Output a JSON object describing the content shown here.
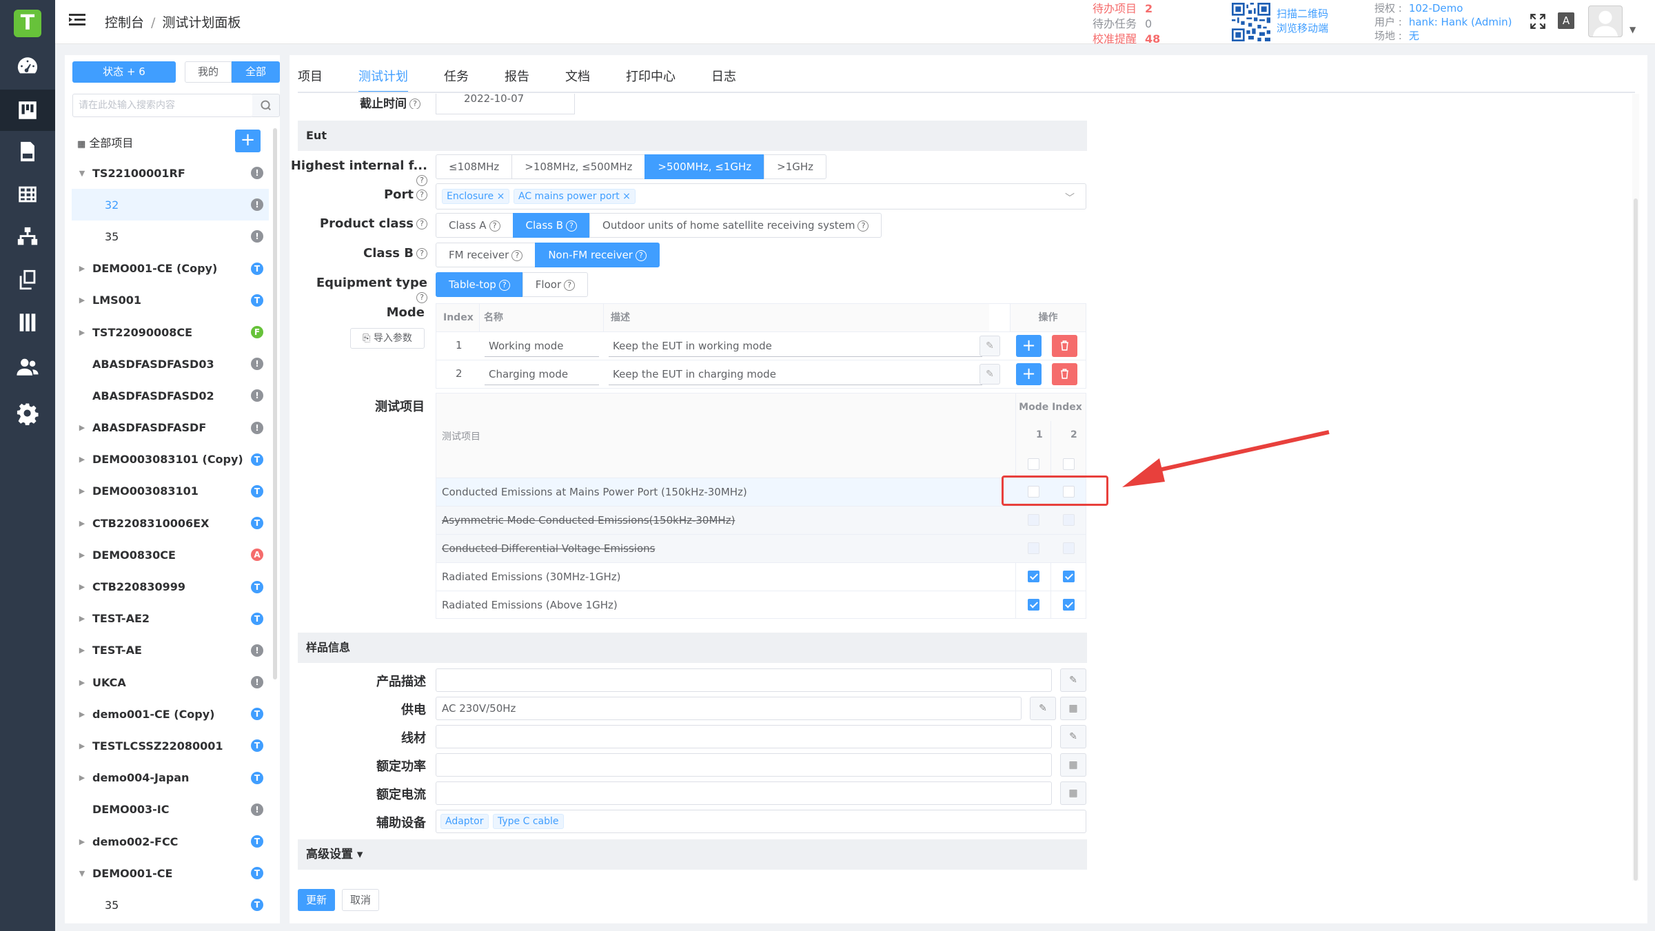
{
  "app": {
    "logo": "T"
  },
  "header": {
    "breadcrumb": [
      "控制台",
      "测试计划面板"
    ],
    "todo": [
      {
        "label": "待办项目",
        "value": "2",
        "color": "#f56c6c"
      },
      {
        "label": "待办任务",
        "value": "0",
        "color": "#909399"
      },
      {
        "label": "校准提醒",
        "value": "48",
        "color": "#f56c6c"
      }
    ],
    "qr": [
      "扫描二维码",
      "浏览移动端"
    ],
    "account": [
      {
        "label": "授权",
        "value": "102-Demo"
      },
      {
        "label": "用户",
        "value": "hank: Hank (Admin)"
      },
      {
        "label": "场地",
        "value": "无"
      }
    ],
    "font_button": "A"
  },
  "nav": [
    "dashboard-icon",
    "board-icon",
    "doc-icon",
    "table-icon",
    "sitemap-icon",
    "copy-icon",
    "book-icon",
    "users-icon",
    "gear-icon"
  ],
  "projects": {
    "status_button": "状态 + 6",
    "mine_button": "我的",
    "all_button": "全部",
    "search_placeholder": "请在此处输入搜索内容",
    "all_projects": "全部项目",
    "tree": [
      {
        "label": "TS22100001RF",
        "arrow": "▼",
        "badge": "!",
        "color": "#909399"
      },
      {
        "label": "32",
        "sub": true,
        "selected": true,
        "badge": "!",
        "color": "#909399"
      },
      {
        "label": "35",
        "sub": true,
        "badge": "!",
        "color": "#909399"
      },
      {
        "label": "DEMO001-CE (Copy)",
        "arrow": "▶",
        "badge": "T",
        "color": "#409eff"
      },
      {
        "label": "LMS001",
        "arrow": "▶",
        "badge": "T",
        "color": "#409eff"
      },
      {
        "label": "TST22090008CE",
        "arrow": "▶",
        "badge": "F",
        "color": "#67c23a"
      },
      {
        "label": "ABASDFASDFASD03",
        "arrow": "",
        "badge": "!",
        "color": "#909399"
      },
      {
        "label": "ABASDFASDFASD02",
        "arrow": "",
        "badge": "!",
        "color": "#909399"
      },
      {
        "label": "ABASDFASDFASDF",
        "arrow": "▶",
        "badge": "!",
        "color": "#909399"
      },
      {
        "label": "DEMO003083101 (Copy)",
        "arrow": "▶",
        "badge": "T",
        "color": "#409eff"
      },
      {
        "label": "DEMO003083101",
        "arrow": "▶",
        "badge": "T",
        "color": "#409eff"
      },
      {
        "label": "CTB2208310006EX",
        "arrow": "▶",
        "badge": "T",
        "color": "#409eff"
      },
      {
        "label": "DEMO0830CE",
        "arrow": "▶",
        "badge": "A",
        "color": "#f56c6c"
      },
      {
        "label": "CTB220830999",
        "arrow": "▶",
        "badge": "T",
        "color": "#409eff"
      },
      {
        "label": "TEST-AE2",
        "arrow": "▶",
        "badge": "T",
        "color": "#409eff"
      },
      {
        "label": "TEST-AE",
        "arrow": "▶",
        "badge": "!",
        "color": "#909399"
      },
      {
        "label": "UKCA",
        "arrow": "▶",
        "badge": "!",
        "color": "#909399"
      },
      {
        "label": "demo001-CE (Copy)",
        "arrow": "▶",
        "badge": "T",
        "color": "#409eff"
      },
      {
        "label": "TESTLCSSZ22080001",
        "arrow": "▶",
        "badge": "T",
        "color": "#409eff"
      },
      {
        "label": "demo004-Japan",
        "arrow": "▶",
        "badge": "T",
        "color": "#409eff"
      },
      {
        "label": "DEMO003-IC",
        "arrow": "",
        "badge": "!",
        "color": "#909399"
      },
      {
        "label": "demo002-FCC",
        "arrow": "▶",
        "badge": "T",
        "color": "#409eff"
      },
      {
        "label": "DEMO001-CE",
        "arrow": "▼",
        "badge": "T",
        "color": "#409eff"
      },
      {
        "label": "35",
        "sub": true,
        "badge": "T",
        "color": "#409eff"
      }
    ]
  },
  "tabs": [
    "项目",
    "测试计划",
    "任务",
    "报告",
    "文档",
    "打印中心",
    "日志"
  ],
  "active_tab": 1,
  "form": {
    "deadline_label": "截止时间",
    "deadline_value": "2022-10-07",
    "eut_section": "Eut",
    "freq_label": "Highest internal f...",
    "freq_options": [
      "≤108MHz",
      ">108MHz, ≤500MHz",
      ">500MHz, ≤1GHz",
      ">1GHz"
    ],
    "freq_selected": 2,
    "port_label": "Port",
    "port_tags": [
      "Enclosure",
      "AC mains power port"
    ],
    "class_label": "Product class",
    "class_options": [
      "Class A",
      "Class B",
      "Outdoor units of home satellite receiving system"
    ],
    "class_selected": 1,
    "classb_label": "Class B",
    "classb_options": [
      "FM receiver",
      "Non-FM receiver"
    ],
    "classb_selected": 1,
    "equip_label": "Equipment type",
    "equip_options": [
      "Table-top",
      "Floor"
    ],
    "equip_selected": 0,
    "mode_label": "Mode",
    "import_button": "导入参数",
    "mode_headers": [
      "Index",
      "名称",
      "描述",
      "操作"
    ],
    "modes": [
      {
        "index": "1",
        "name": "Working mode",
        "desc": "Keep the EUT in working mode"
      },
      {
        "index": "2",
        "name": "Charging mode",
        "desc": "Keep the EUT in charging mode"
      }
    ],
    "test_label": "测试项目",
    "test_header": "测试项目",
    "mode_index_header": "Mode Index",
    "mode_cols": [
      "1",
      "2"
    ],
    "tests": [
      {
        "name": "Conducted Emissions at Mains Power Port (150kHz-30MHz)",
        "c1": false,
        "c2": false,
        "strike": false,
        "hl": true
      },
      {
        "name": "Asymmetric Mode Conducted Emissions(150kHz-30MHz)",
        "c1": false,
        "c2": false,
        "strike": true
      },
      {
        "name": "Conducted Differential Voltage Emissions",
        "c1": false,
        "c2": false,
        "strike": true
      },
      {
        "name": "Radiated Emissions (30MHz-1GHz)",
        "c1": true,
        "c2": true,
        "strike": false
      },
      {
        "name": "Radiated Emissions (Above 1GHz)",
        "c1": true,
        "c2": true,
        "strike": false
      }
    ],
    "sample_section": "样品信息",
    "product_desc_label": "产品描述",
    "product_desc_value": "",
    "power_label": "供电",
    "power_value": "AC 230V/50Hz",
    "cable_label": "线材",
    "cable_value": "",
    "rated_power_label": "额定功率",
    "rated_power_value": "",
    "rated_current_label": "额定电流",
    "rated_current_value": "",
    "aux_label": "辅助设备",
    "aux_tags": [
      "Adaptor",
      "Type C cable"
    ],
    "advanced": "高级设置 ▾",
    "update_button": "更新",
    "cancel_button": "取消"
  },
  "colors": {
    "primary": "#409eff",
    "danger": "#f56c6c",
    "nav_bg": "#2f3a4a",
    "annotation": "#e8403c"
  }
}
